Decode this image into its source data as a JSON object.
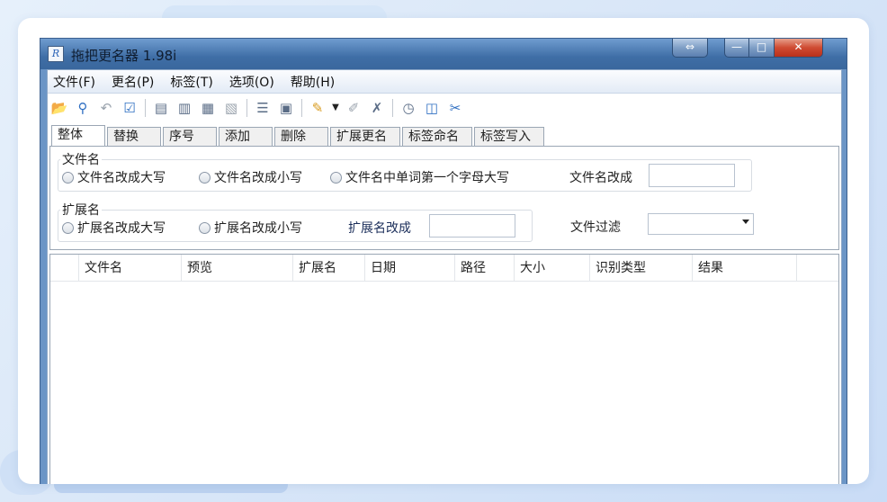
{
  "window": {
    "title": "拖把更名器 1.98i",
    "icon": "app-icon",
    "controls": {
      "swap": "⇔",
      "minimize": "—",
      "maximize": "□",
      "close": "✕"
    }
  },
  "menu": [
    "文件(F)",
    "更名(P)",
    "标签(T)",
    "选项(O)",
    "帮助(H)"
  ],
  "toolbar": {
    "icons": [
      "open-folder-icon",
      "search-icon",
      "undo-icon",
      "check-icon",
      "tag-icon-1",
      "tag-icon-2",
      "tag-icon-3",
      "tag-icon-4",
      "list-icon",
      "doc-icon",
      "pencil-icon",
      "dropdown-icon",
      "tag-edit-icon",
      "tag-delete-icon",
      "clock-icon",
      "panel-icon",
      "tools-icon"
    ]
  },
  "tabs": [
    "整体",
    "替换",
    "序号",
    "添加",
    "删除",
    "扩展更名",
    "标签命名",
    "标签写入"
  ],
  "filename_group": {
    "label": "文件名",
    "options": [
      "文件名改成大写",
      "文件名改成小写",
      "文件名中单词第一个字母大写"
    ],
    "rename_label": "文件名改成",
    "rename_value": ""
  },
  "extension_group": {
    "label": "扩展名",
    "options": [
      "扩展名改成大写",
      "扩展名改成小写"
    ],
    "rename_label": "扩展名改成",
    "rename_value": ""
  },
  "filter": {
    "label": "文件过滤",
    "value": ""
  },
  "list": {
    "columns": [
      "文件名",
      "预览",
      "扩展名",
      "日期",
      "路径",
      "大小",
      "识别类型",
      "结果"
    ]
  }
}
